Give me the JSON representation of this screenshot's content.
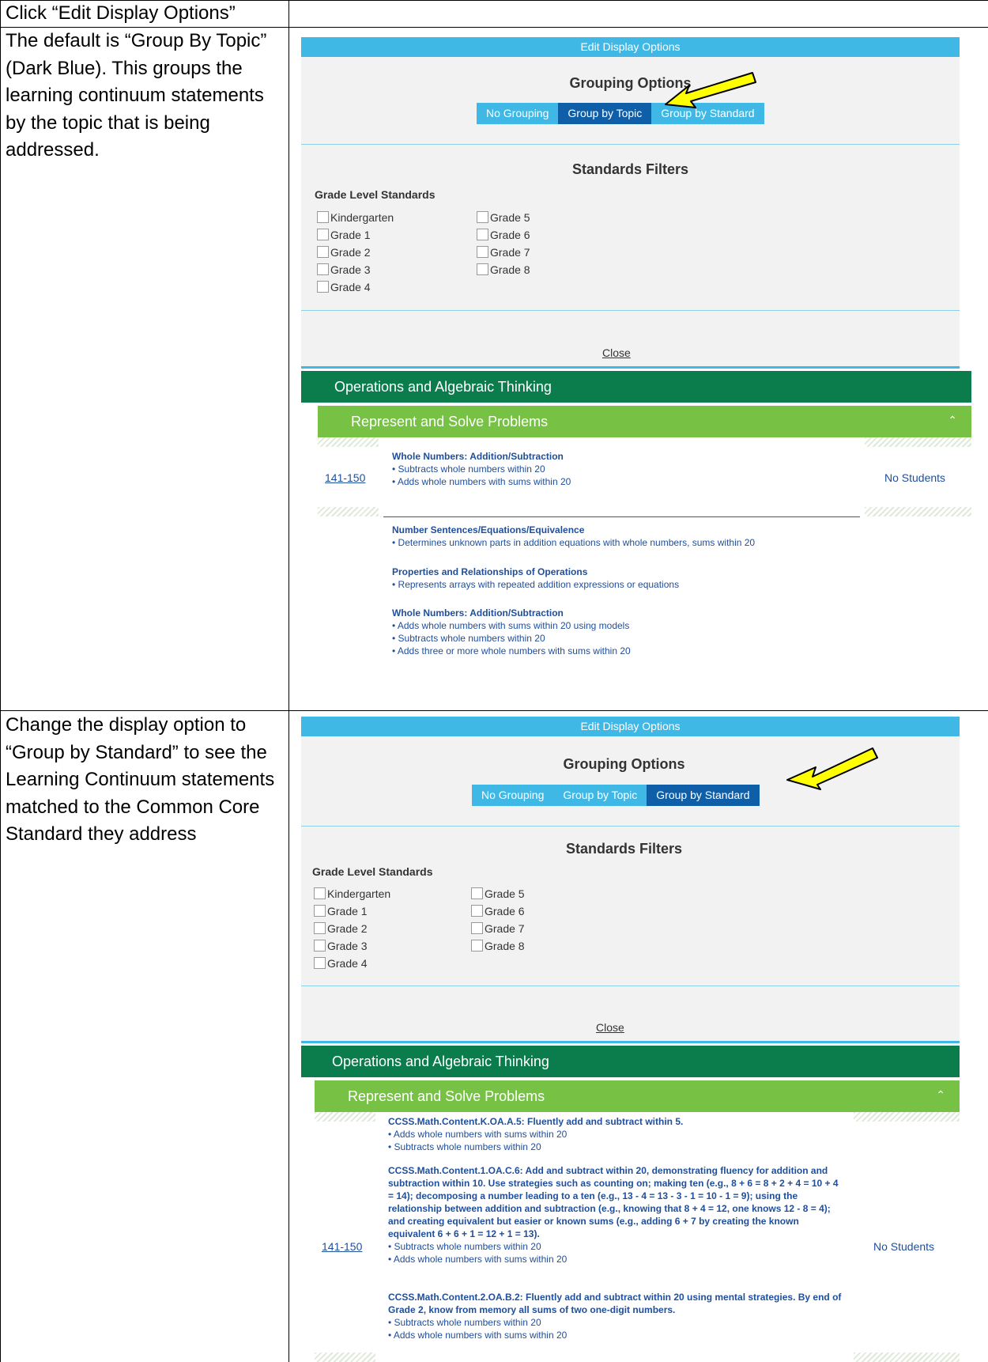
{
  "doc": {
    "header": "Click “Edit Display Options”",
    "step1_text": "The default is “Group By Topic” (Dark Blue). This groups the learning continuum statements by the topic that is being addressed.",
    "step2_text": "Change the display option to “Group by Standard” to see the Learning Continuum statements matched to the Common Core Standard they address"
  },
  "screen1": {
    "panel_title": "Edit Display Options",
    "grouping_title": "Grouping Options",
    "grouping": [
      "No Grouping",
      "Group by Topic",
      "Group by Standard"
    ],
    "grouping_selected": "Group by Topic",
    "filters_title": "Standards Filters",
    "grade_label": "Grade Level Standards",
    "grades_col1": [
      "Kindergarten",
      "Grade 1",
      "Grade 2",
      "Grade 3",
      "Grade 4"
    ],
    "grades_col2": [
      "Grade 5",
      "Grade 6",
      "Grade 7",
      "Grade 8"
    ],
    "close_label": "Close",
    "domain_bar": "Operations and Algebraic Thinking",
    "cluster_bar": "Represent and Solve Problems",
    "range_link": "141-150",
    "no_students": "No Students",
    "topics": [
      {
        "heading": "Whole Numbers: Addition/Subtraction",
        "items": [
          "• Subtracts whole numbers within 20",
          "• Adds whole numbers with sums within 20"
        ]
      },
      {
        "heading": "Number Sentences/Equations/Equivalence",
        "items": [
          "• Determines unknown parts in addition equations with whole numbers, sums within 20"
        ]
      },
      {
        "heading": "Properties and Relationships of Operations",
        "items": [
          "• Represents arrays with repeated addition expressions or equations"
        ]
      },
      {
        "heading": "Whole Numbers: Addition/Subtraction",
        "items": [
          "• Adds whole numbers with sums within 20 using models",
          "• Subtracts whole numbers within 20",
          "• Adds three or more whole numbers with sums within 20"
        ]
      }
    ]
  },
  "screen2": {
    "panel_title": "Edit Display Options",
    "grouping_title": "Grouping Options",
    "grouping": [
      "No Grouping",
      "Group by Topic",
      "Group by Standard"
    ],
    "grouping_selected": "Group by Standard",
    "filters_title": "Standards Filters",
    "grade_label": "Grade Level Standards",
    "grades_col1": [
      "Kindergarten",
      "Grade 1",
      "Grade 2",
      "Grade 3",
      "Grade 4"
    ],
    "grades_col2": [
      "Grade 5",
      "Grade 6",
      "Grade 7",
      "Grade 8"
    ],
    "close_label": "Close",
    "domain_bar": "Operations and Algebraic Thinking",
    "cluster_bar": "Represent and Solve Problems",
    "range_link": "141-150",
    "no_students": "No Students",
    "standards": [
      {
        "heading": "CCSS.Math.Content.K.OA.A.5: Fluently add and subtract within 5.",
        "items": [
          "• Adds whole numbers with sums within 20",
          "• Subtracts whole numbers within 20"
        ]
      },
      {
        "heading": "CCSS.Math.Content.1.OA.C.6: Add and subtract within 20, demonstrating fluency for addition and subtraction within 10. Use strategies such as counting on; making ten (e.g., 8 + 6 = 8 + 2 + 4 = 10 + 4 = 14); decomposing a number leading to a ten (e.g., 13 - 4 = 13 - 3 - 1 = 10 - 1 = 9); using the relationship between addition and subtraction (e.g., knowing that 8 + 4 = 12, one knows 12 - 8 = 4); and creating equivalent but easier or known sums (e.g., adding 6 + 7 by creating the known equivalent 6 + 6 + 1 = 12 + 1 = 13).",
        "items": [
          "• Subtracts whole numbers within 20",
          "• Adds whole numbers with sums within 20"
        ]
      },
      {
        "heading": "CCSS.Math.Content.2.OA.B.2: Fluently add and subtract within 20 using mental strategies. By end of Grade 2, know from memory all sums of two one-digit numbers.",
        "items": [
          "• Subtracts whole numbers within 20",
          "• Adds whole numbers with sums within 20"
        ]
      }
    ]
  },
  "colors": {
    "light_blue": "#3fb8e6",
    "dark_blue": "#0f5ea8",
    "dark_green": "#0b7d4d",
    "light_green": "#77c145",
    "arrow_yellow": "#ffff00"
  }
}
